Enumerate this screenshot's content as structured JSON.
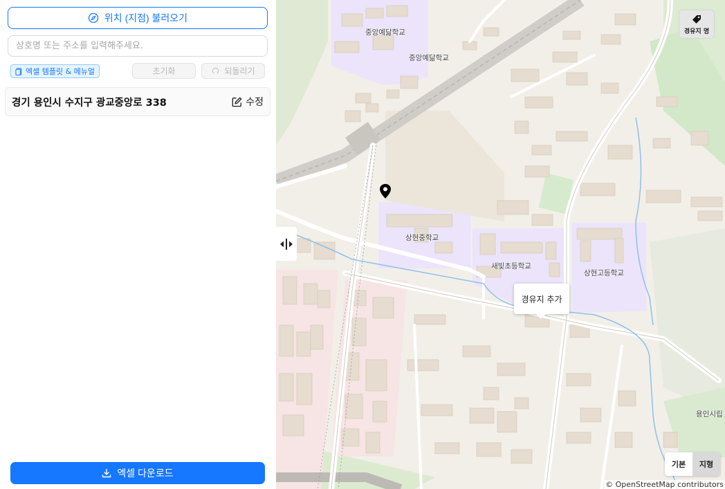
{
  "sidebar": {
    "load_button": {
      "label": "위치 (지점) 불러오기",
      "icon": "compass-icon"
    },
    "search": {
      "placeholder": "상호명 또는 주소를 입력해주세요.",
      "value": ""
    },
    "template_button": {
      "label": "엑셀 템플릿 & 메뉴얼",
      "icon": "file-icon"
    },
    "reset_button": {
      "label": "초기화"
    },
    "undo_button": {
      "label": "되돌리기",
      "icon": "undo-icon"
    },
    "address_card": {
      "address": "경기 용인시 수지구 광교중앙로 338",
      "edit_label": "수정",
      "edit_icon": "edit-icon"
    },
    "download_button": {
      "label": "엑셀 다운로드",
      "icon": "download-icon"
    }
  },
  "map": {
    "labels": {
      "school_1_building": "중앙예닮학교",
      "school_1_area": "중앙예닮학교",
      "school_2": "상현중학교",
      "school_3": "새빛초등학교",
      "school_4": "상현고등학교",
      "district": "용인시립"
    },
    "popup_label": "경유지 추가",
    "waypoint_button_label": "경유지 명",
    "layer_toggle": {
      "basic": "기본",
      "terrain": "지형",
      "active": "기본"
    },
    "attribution": "© OpenStreetMap contributors",
    "colors": {
      "land": "#f2efe9",
      "school": "#ebe4fb",
      "building": "#e6dccf",
      "residential": "#f7e3e3",
      "water": "#7fb8e6",
      "park": "#d8ecd0",
      "accent": "#1677ff"
    }
  }
}
